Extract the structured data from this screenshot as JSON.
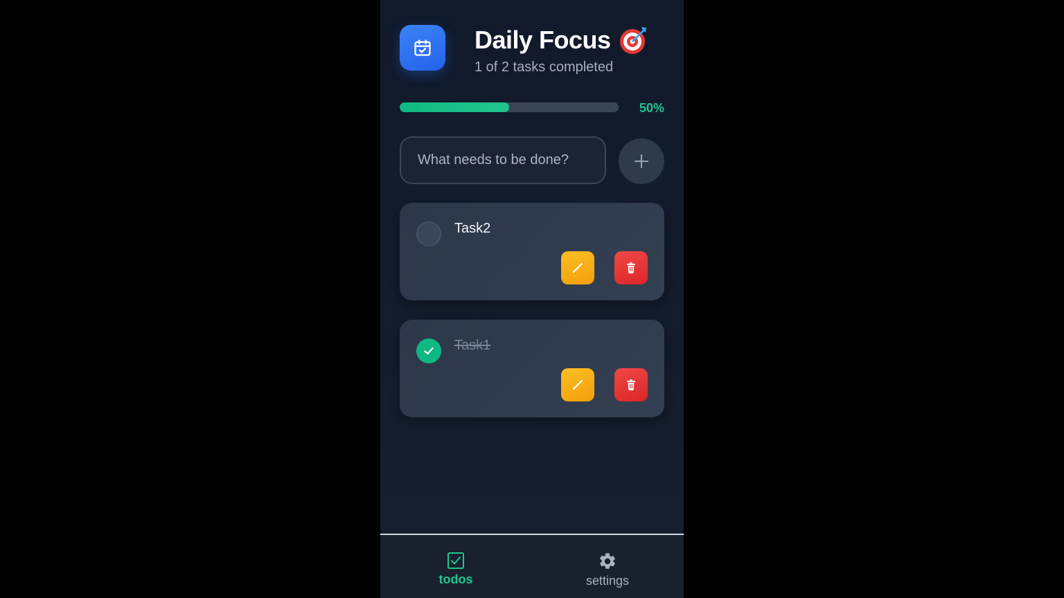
{
  "header": {
    "title": "Daily Focus",
    "subtitle": "1 of 2 tasks completed",
    "app_icon": "calendar-check-icon",
    "title_emoji": "target-icon"
  },
  "progress": {
    "percent_label": "50%",
    "fraction": 0.5,
    "color": "#22c58f"
  },
  "new_task": {
    "placeholder": "What needs to be done?",
    "add_icon": "plus-icon"
  },
  "tasks": [
    {
      "label": "Task2",
      "completed": false
    },
    {
      "label": "Task1",
      "completed": true
    }
  ],
  "nav": {
    "items": [
      {
        "label": "todos",
        "icon": "checkbox-icon",
        "active": true
      },
      {
        "label": "settings",
        "icon": "gear-icon",
        "active": false
      }
    ]
  },
  "colors": {
    "accent_green": "#10b981",
    "accent_blue": "#2563eb",
    "edit": "#f59e0b",
    "delete": "#dc2626"
  }
}
